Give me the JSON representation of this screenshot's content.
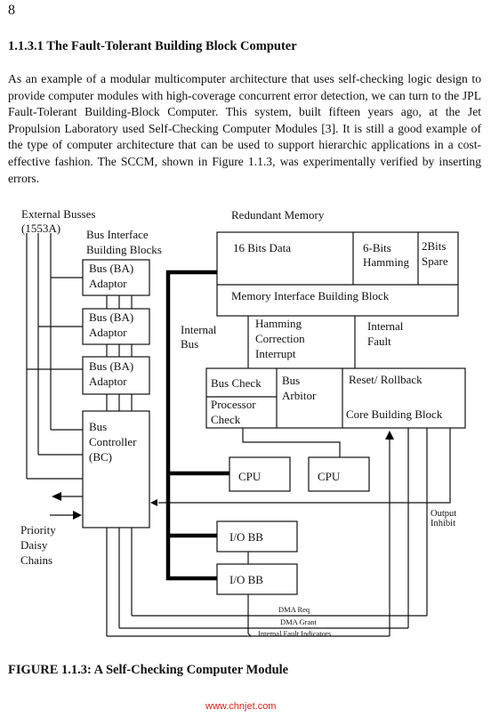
{
  "page": {
    "number": "8",
    "section_heading": "1.1.3.1 The Fault-Tolerant Building Block Computer",
    "paragraph": "As an example of a modular multicomputer architecture that uses self-checking logic design to provide computer modules with high-coverage concurrent error detection, we can turn to the JPL Fault-Tolerant Building-Block Computer. This system, built fifteen years ago, at the Jet Propulsion Laboratory used Self-Checking Computer Modules [3]. It is still a good example of the type of computer architecture that can be used to support hierarchic applications in a cost-effective fashion. The SCCM, shown in Figure 1.1.3, was experimentally verified by inserting errors.",
    "figure_caption": "FIGURE 1.1.3: A Self-Checking Computer Module",
    "watermark": "www.chnjet.com"
  },
  "figure": {
    "external_busses": [
      "External Busses",
      "(1553A)"
    ],
    "bus_interface_title": [
      "Bus Interface",
      "Building Blocks"
    ],
    "bus_adaptors": [
      [
        "Bus  (BA)",
        "Adaptor"
      ],
      [
        "Bus  (BA)",
        "Adaptor"
      ],
      [
        "Bus  (BA)",
        "Adaptor"
      ]
    ],
    "bus_controller": [
      "Bus",
      "Controller",
      "(BC)"
    ],
    "priority_chains": [
      "Priority",
      "Daisy",
      "Chains"
    ],
    "internal_bus": [
      "Internal",
      "Bus"
    ],
    "redundant_memory_title": "Redundant Memory",
    "memory_fields": {
      "data": "16 Bits Data",
      "hamming": [
        "6-Bits",
        "Hamming"
      ],
      "spare": [
        "2Bits",
        "Spare"
      ]
    },
    "memory_interface": "Memory Interface Building Block",
    "hamming_interrupt": [
      "Hamming",
      "Correction",
      "Interrupt"
    ],
    "internal_fault": [
      "Internal",
      "Fault"
    ],
    "core": {
      "bus_check": "Bus Check",
      "processor_check": [
        "Processor",
        "Check"
      ],
      "bus_arbitor": [
        "Bus",
        "Arbitor"
      ],
      "reset_rollback": "Reset/ Rollback",
      "core_block": "Core Building Block"
    },
    "cpus": [
      "CPU",
      "CPU"
    ],
    "io_blocks": [
      "I/O  BB",
      "I/O  BB"
    ],
    "output_inhibit": [
      "Output",
      "Inhibit"
    ],
    "signal_lines": {
      "dma_req": "DMA Req",
      "dma_grant": "DMA Grant",
      "fault_indicators": "Internal Fault Indicators"
    }
  }
}
